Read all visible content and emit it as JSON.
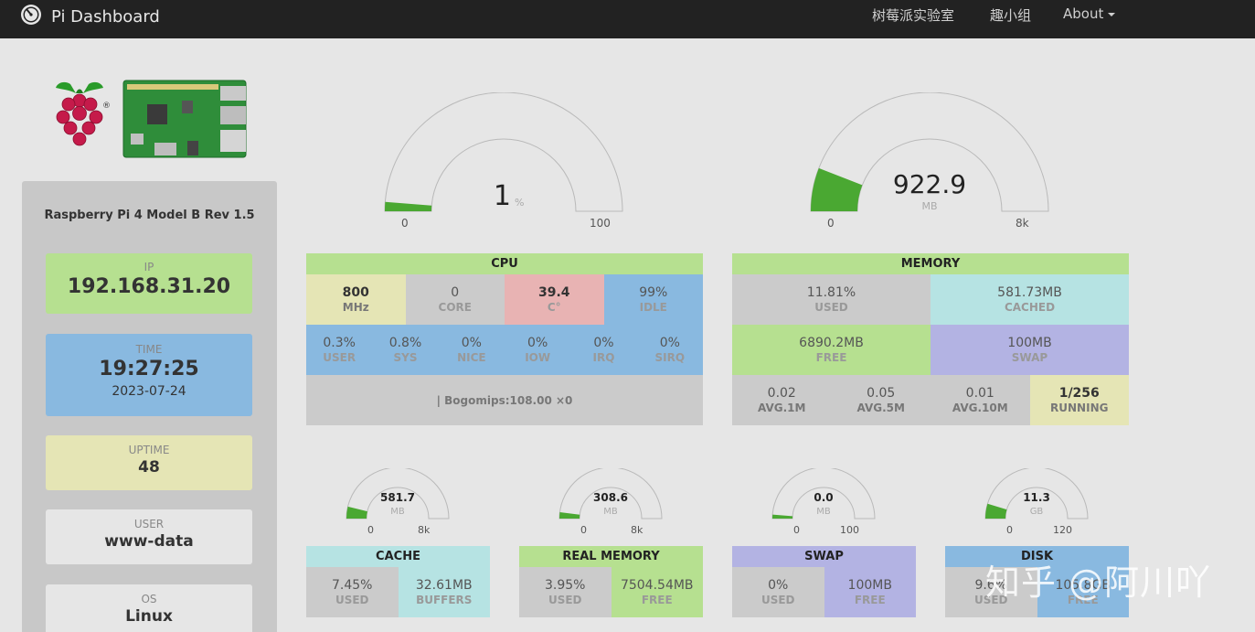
{
  "navbar": {
    "title": "Pi Dashboard",
    "links": [
      "树莓派实验室",
      "趣小组"
    ],
    "about": "About"
  },
  "sidebar": {
    "model": "Raspberry Pi 4 Model B Rev 1.5",
    "ip": {
      "label": "IP",
      "value": "192.168.31.20"
    },
    "time": {
      "label": "TIME",
      "value": "19:27:25",
      "date": "2023-07-24"
    },
    "uptime": {
      "label": "UPTIME",
      "value": "48"
    },
    "user": {
      "label": "USER",
      "value": "www-data"
    },
    "os": {
      "label": "OS",
      "value": "Linux"
    }
  },
  "gauges": {
    "cpu": {
      "value": "1",
      "unit": "%",
      "min": "0",
      "max": "100",
      "fraction": 0.01
    },
    "memory": {
      "value": "922.9",
      "unit": "MB",
      "min": "0",
      "max": "8k",
      "fraction": 0.118
    },
    "cache": {
      "value": "581.7",
      "unit": "MB",
      "min": "0",
      "max": "8k",
      "fraction": 0.075
    },
    "real": {
      "value": "308.6",
      "unit": "MB",
      "min": "0",
      "max": "8k",
      "fraction": 0.04
    },
    "swap": {
      "value": "0.0",
      "unit": "MB",
      "min": "0",
      "max": "100",
      "fraction": 0.0
    },
    "disk": {
      "value": "11.3",
      "unit": "GB",
      "min": "0",
      "max": "120",
      "fraction": 0.094
    }
  },
  "cpu": {
    "title": "CPU",
    "freq": {
      "value": "800",
      "label": "MHz"
    },
    "core": {
      "value": "0",
      "label": "CORE"
    },
    "temp": {
      "value": "39.4",
      "label": "C°"
    },
    "idle": {
      "value": "99%",
      "label": "IDLE"
    },
    "stats": [
      {
        "value": "0.3%",
        "label": "USER"
      },
      {
        "value": "0.8%",
        "label": "SYS"
      },
      {
        "value": "0%",
        "label": "NICE"
      },
      {
        "value": "0%",
        "label": "IOW"
      },
      {
        "value": "0%",
        "label": "IRQ"
      },
      {
        "value": "0%",
        "label": "SIRQ"
      }
    ],
    "bogomips": "| Bogomips:108.00 ×0"
  },
  "memory": {
    "title": "MEMORY",
    "used": {
      "value": "11.81%",
      "label": "USED"
    },
    "cached": {
      "value": "581.73MB",
      "label": "CACHED"
    },
    "free": {
      "value": "6890.2MB",
      "label": "FREE"
    },
    "swap": {
      "value": "100MB",
      "label": "SWAP"
    },
    "avg1": {
      "value": "0.02",
      "label": "AVG.1M"
    },
    "avg5": {
      "value": "0.05",
      "label": "AVG.5M"
    },
    "avg10": {
      "value": "0.01",
      "label": "AVG.10M"
    },
    "running": {
      "value": "1/256",
      "label": "RUNNING"
    }
  },
  "cache": {
    "title": "CACHE",
    "used": {
      "value": "7.45%",
      "label": "USED"
    },
    "buffers": {
      "value": "32.61MB",
      "label": "BUFFERS"
    }
  },
  "real_memory": {
    "title": "REAL MEMORY",
    "used": {
      "value": "3.95%",
      "label": "USED"
    },
    "free": {
      "value": "7504.54MB",
      "label": "FREE"
    }
  },
  "swap": {
    "title": "SWAP",
    "used": {
      "value": "0%",
      "label": "USED"
    },
    "free": {
      "value": "100MB",
      "label": "FREE"
    }
  },
  "disk": {
    "title": "DISK",
    "used": {
      "value": "9.6%",
      "label": "USED"
    },
    "free": {
      "value": "105.8GB",
      "label": "FREE"
    }
  },
  "watermark": "知乎 @阿川吖",
  "colors": {
    "green": "#b6e090",
    "blue": "#89b9e0",
    "yellow": "#e5e5b5",
    "red": "#e8b3b3",
    "teal": "#b6e3e3",
    "purple": "#b3b3e3",
    "gauge_fill": "#4aa832"
  }
}
